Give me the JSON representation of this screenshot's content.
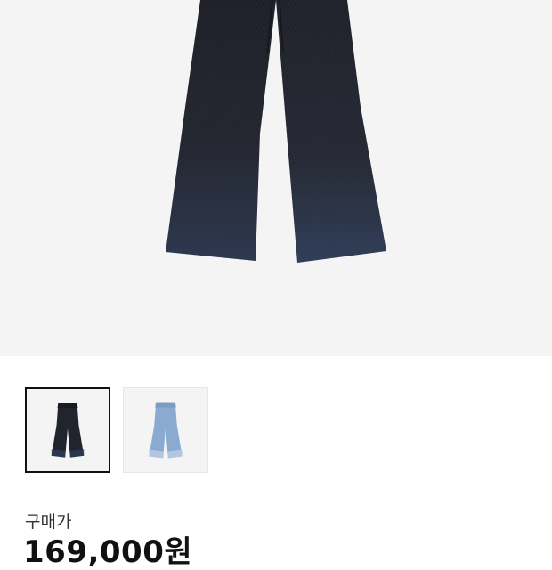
{
  "product": {
    "image_icon": "dark-denim-flare-jeans",
    "thumbnails": [
      {
        "icon": "dark-denim-jeans-thumbnail",
        "selected": true
      },
      {
        "icon": "light-denim-jeans-thumbnail",
        "selected": false
      }
    ]
  },
  "pricing": {
    "label": "구매가",
    "value": "169,000원"
  },
  "colors": {
    "dark_denim": "#22242d",
    "light_denim": "#8aaad0",
    "background": "#f4f4f4",
    "selected_border": "#111111"
  }
}
